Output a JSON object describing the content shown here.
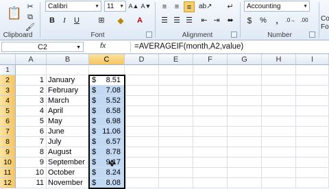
{
  "ribbon": {
    "clipboard_label": "Clipboard",
    "font_label": "Font",
    "alignment_label": "Alignment",
    "number_label": "Number",
    "font_name": "Calibri",
    "font_size": "11",
    "number_format": "Accounting",
    "cond_label": "Co",
    "format_label": "For"
  },
  "formula_bar": {
    "name_box": "C2",
    "fx": "fx",
    "formula": "=AVERAGEIF(month,A2,value)"
  },
  "columns": [
    "A",
    "B",
    "C",
    "D",
    "E",
    "F",
    "G",
    "H",
    "I"
  ],
  "rows": [
    {
      "num": "1",
      "a": "",
      "b": "",
      "c_dollar": "",
      "c": ""
    },
    {
      "num": "2",
      "a": "1",
      "b": "January",
      "c_dollar": "$",
      "c": "8.51"
    },
    {
      "num": "3",
      "a": "2",
      "b": "February",
      "c_dollar": "$",
      "c": "7.08"
    },
    {
      "num": "4",
      "a": "3",
      "b": "March",
      "c_dollar": "$",
      "c": "5.52"
    },
    {
      "num": "5",
      "a": "4",
      "b": "April",
      "c_dollar": "$",
      "c": "6.58"
    },
    {
      "num": "6",
      "a": "5",
      "b": "May",
      "c_dollar": "$",
      "c": "6.98"
    },
    {
      "num": "7",
      "a": "6",
      "b": "June",
      "c_dollar": "$",
      "c": "11.06"
    },
    {
      "num": "8",
      "a": "7",
      "b": "July",
      "c_dollar": "$",
      "c": "6.57"
    },
    {
      "num": "9",
      "a": "8",
      "b": "August",
      "c_dollar": "$",
      "c": "8.78"
    },
    {
      "num": "10",
      "a": "9",
      "b": "September",
      "c_dollar": "$",
      "c": "9.17"
    },
    {
      "num": "11",
      "a": "10",
      "b": "October",
      "c_dollar": "$",
      "c": "8.24"
    },
    {
      "num": "12",
      "a": "11",
      "b": "November",
      "c_dollar": "$",
      "c": "8.08"
    }
  ]
}
